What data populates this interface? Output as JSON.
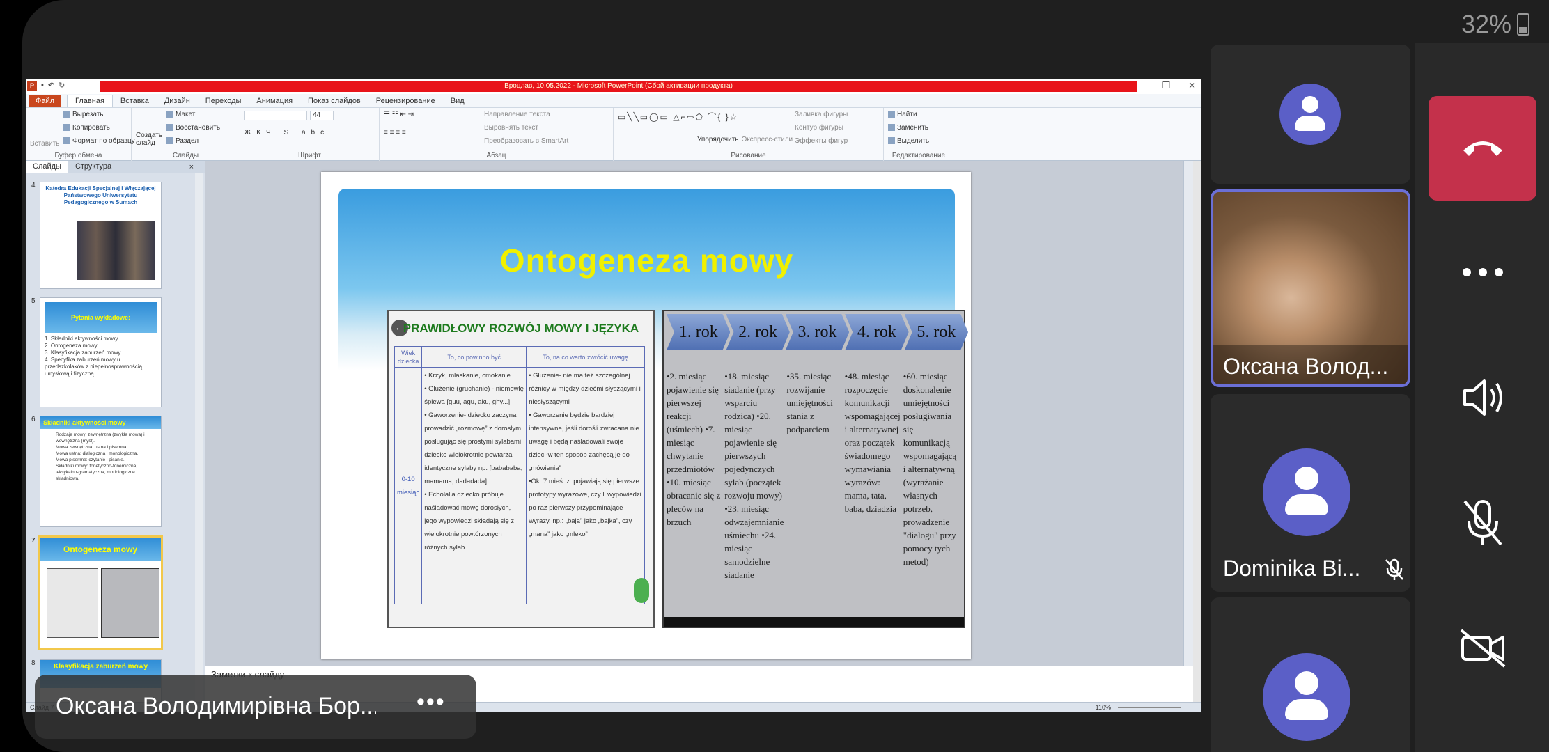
{
  "status": {
    "battery": "32%"
  },
  "ppt": {
    "window_title": "Вроцлав, 10.05.2022 - Microsoft PowerPoint (Сбой активации продукта)",
    "menu": {
      "file": "Файл",
      "tabs": [
        "Главная",
        "Вставка",
        "Дизайн",
        "Переходы",
        "Анимация",
        "Показ слайдов",
        "Рецензирование",
        "Вид"
      ]
    },
    "ribbon": {
      "paste": "Вставить",
      "cut": "Вырезать",
      "copy": "Копировать",
      "format_painter": "Формат по образцу",
      "clipboard": "Буфер обмена",
      "new_slide": "Создать слайд",
      "layout": "Макет",
      "reset": "Восстановить",
      "section": "Раздел",
      "slides": "Слайды",
      "font_size": "44",
      "font_group": "Шрифт",
      "text_direction": "Направление текста",
      "align_text": "Выровнять текст",
      "smartart": "Преобразовать в SmartArt",
      "paragraph": "Абзац",
      "arrange": "Упорядочить",
      "quick_styles": "Экспресс-стили",
      "shape_fill": "Заливка фигуры",
      "shape_outline": "Контур фигуры",
      "shape_effects": "Эффекты фигур",
      "drawing": "Рисование",
      "find": "Найти",
      "replace": "Заменить",
      "select": "Выделить",
      "editing": "Редактирование"
    },
    "pane": {
      "tab_slides": "Слайды",
      "tab_outline": "Структура",
      "close": "×"
    },
    "thumbs": {
      "t4": {
        "num": "4",
        "title": "Katedra Edukacji Specjalnej i Włączającej Państwowego Uniwersytetu Pedagogicznego w Sumach"
      },
      "t5": {
        "num": "5",
        "title": "Pytania wykładowe:",
        "lines": [
          "1. Składniki aktywności mowy",
          "2. Ontogeneza mowy",
          "3. Klasyfikacja zaburzeń mowy",
          "4. Specyfika zaburzeń mowy u przedszkolaków z niepełnosprawnością umysłową i fizyczną"
        ]
      },
      "t6": {
        "num": "6",
        "title": "Składniki aktywności mowy",
        "lines": [
          "Rodzaje mowy: zewnętrzna (zwykła mowa) i wewnętrzna (myśl).",
          "Mowa zewnętrzna: ustna i pisemna.",
          "Mowa ustna: dialogiczna i monologiczna.",
          "Mowa pisemna: czytanie i pisanie.",
          "Składniki mowy: fonetyczno-fonemiczna, leksykalno-gramatyczna, morfologiczne i składniowa."
        ]
      },
      "t7": {
        "num": "7",
        "title": "Ontogeneza mowy"
      },
      "t8": {
        "num": "8",
        "title": "Klasyfikacja zaburzeń mowy"
      }
    },
    "slide": {
      "title": "Ontogeneza mowy",
      "table": {
        "heading": "PRAWIDŁOWY ROZWÓJ MOWY I JĘZYKA",
        "col_wiek": "Wiek dziecka",
        "col_should": "To, co powinno być",
        "col_note": "To, na co warto zwrócić uwagę",
        "age": "0-10 miesiąc",
        "should": [
          "• Krzyk, mlaskanie, cmokanie.",
          "• Głużenie (gruchanie) - niemowlę śpiewa [guu, agu, aku, ghy...]",
          "• Gaworzenie- dziecko zaczyna prowadzić „rozmowę” z dorosłym posługując się prostymi sylabami dziecko wielokrotnie powtarza identyczne sylaby np. [babababa, mamama, dadadada].",
          "• Echolalia dziecko próbuje naśladować mowę dorosłych, jego wypowiedzi składają się z wielokrotnie powtórzonych różnych sylab."
        ],
        "note": [
          "• Głużenie- nie ma też szczególnej różnicy w między dziećmi słyszącymi i niesłyszącymi",
          "• Gaworzenie będzie bardziej intensywne, jeśli dorośli zwracana nie uwagę i będą naśladowali swoje dzieci-w ten sposób zachęcą je do „mówienia”",
          "•Ok. 7 mieś. ż. pojawiają się pierwsze prototypy wyrazowe, czy li wypowiedzi po raz pierwszy przypominające wyrazy, np.: „baja” jako „bajka”, czy „mana” jako „mleko”"
        ]
      },
      "years": [
        "1. rok",
        "2. rok",
        "3. rok",
        "4. rok",
        "5. rok"
      ],
      "year_cols": [
        "•2. miesiąc pojawienie się pierwszej reakcji (uśmiech) •7. miesiąc chwytanie przedmiotów •10. miesiąc obracanie się z pleców na brzuch",
        "•18. miesiąc siadanie (przy wsparciu rodzica) •20. miesiąc pojawienie się pierwszych pojedynczych sylab (początek rozwoju mowy) •23. miesiąc odwzajemnianie uśmiechu •24. miesiąc samodzielne siadanie",
        "•35. miesiąc rozwijanie umiejętności stania z podparciem",
        "•48. miesiąc rozpoczęcie komunikacji wspomagającej i alternatywnej oraz początek świadomego wymawiania wyrazów: mama, tata, baba, dziadzia",
        "•60. miesiąc doskonalenie umiejętności posługiwania się komunikacją wspomagającą i alternatywną (wyrażanie własnych potrzeb, prowadzenie \"dialogu\" przy pomocy tych metod)"
      ]
    },
    "notes_placeholder": "Заметки к слайду",
    "status_slide": "Слайд 7",
    "zoom": "110%"
  },
  "meeting": {
    "presenter_name": "Оксана Володимирівна Бор...",
    "more": "•••",
    "participants": [
      {
        "name": ""
      },
      {
        "name": "Оксана Волод..."
      },
      {
        "name": "Dominika Bi..."
      },
      {
        "name": ""
      }
    ]
  },
  "icons": [
    "phone-hangup-icon",
    "more-icon",
    "speaker-icon",
    "mic-off-icon",
    "video-off-icon"
  ],
  "colors": {
    "hangup": "#c4314b",
    "avatar": "#5b5fc7",
    "ppt_red": "#e8141a",
    "slide_title": "#f0f000"
  }
}
